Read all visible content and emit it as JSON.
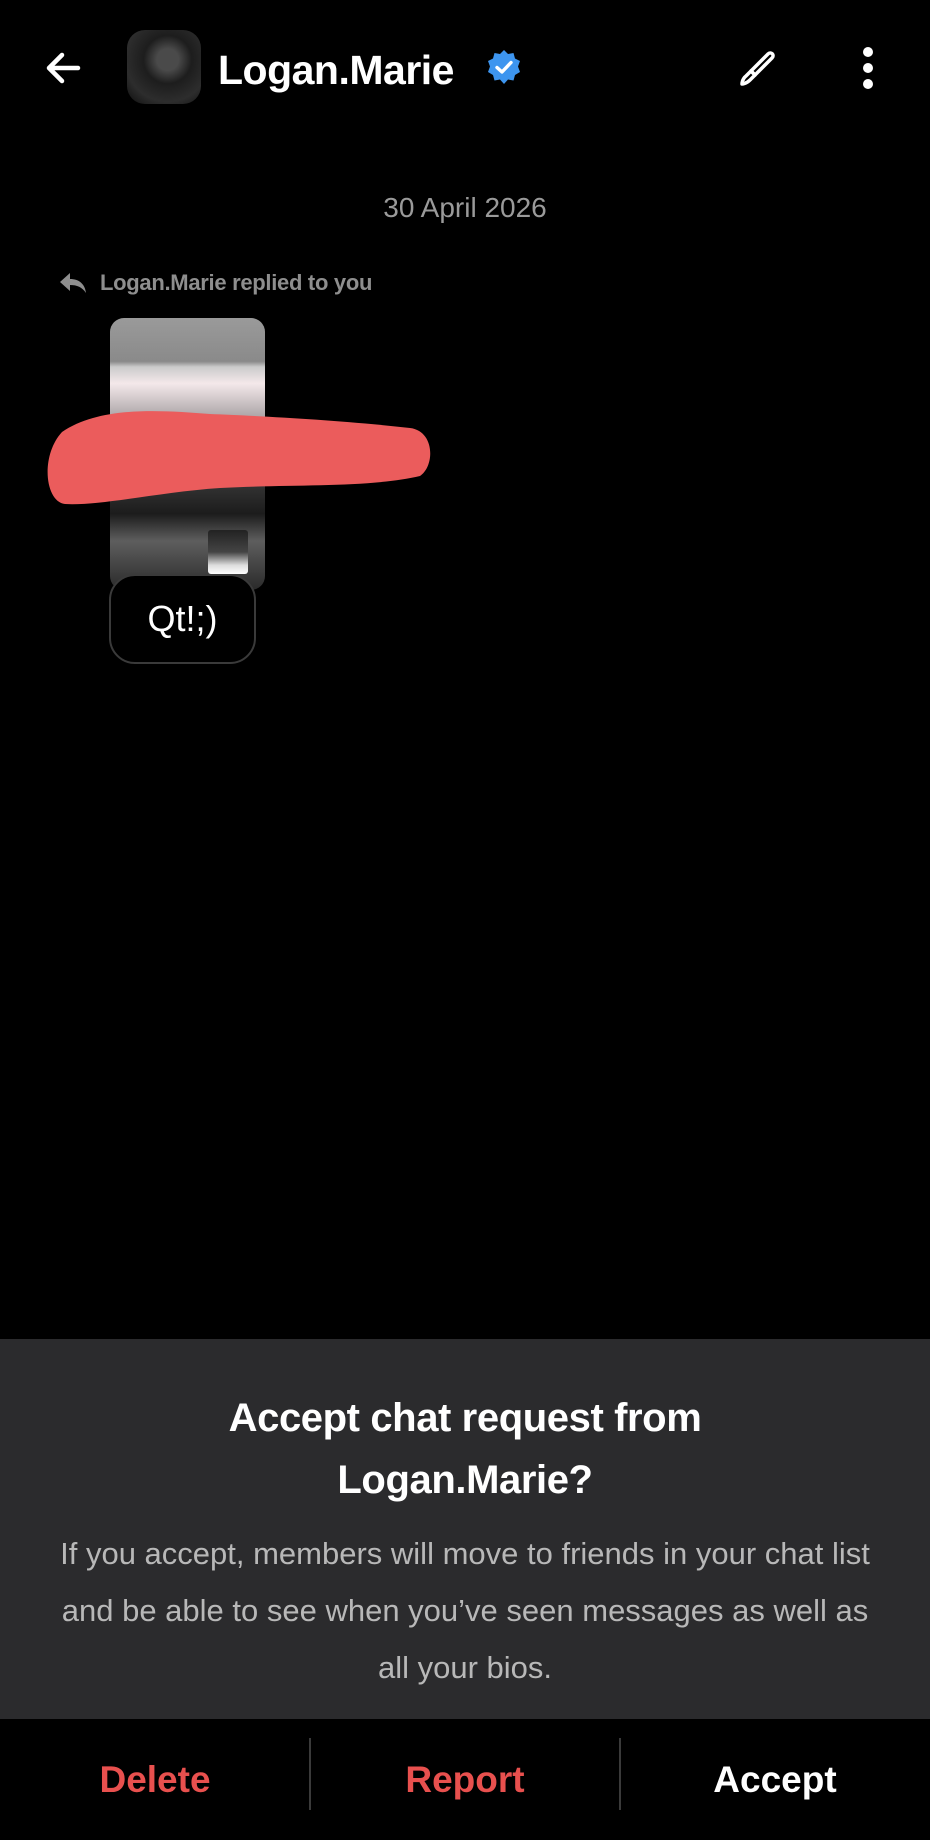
{
  "header": {
    "back_icon": "arrow-left-icon",
    "username": "Logan.Marie",
    "verified_icon": "verified-badge-icon",
    "brush_icon": "paintbrush-icon",
    "more_icon": "more-vertical-icon"
  },
  "chat": {
    "date": "30 April 2026",
    "reply_note": "Logan.Marie replied to you",
    "reply_icon": "reply-arrow-icon",
    "message_text": "Qt!;)"
  },
  "request": {
    "title_line1": "Accept chat request from",
    "title_line2": "Logan.Marie?",
    "body": "If you accept, members will move to friends in your chat list and be able to see when you’ve seen messages as well as all your bios."
  },
  "actions": {
    "delete_label": "Delete",
    "report_label": "Report",
    "accept_label": "Accept"
  },
  "colors": {
    "background": "#000000",
    "panel": "#2b2b2d",
    "destructive": "#e8504e",
    "verified": "#3d95ef",
    "redaction": "#eb5c5c"
  }
}
